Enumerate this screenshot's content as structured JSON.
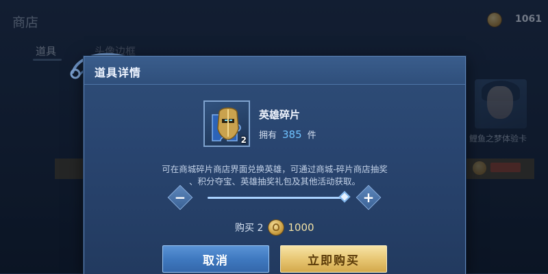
{
  "header": {
    "title": "商店",
    "coin_balance": "1061"
  },
  "tabs": [
    {
      "label": "道具",
      "active": true
    },
    {
      "label": "头像边框",
      "active": false
    }
  ],
  "side_card": {
    "label": "鲤鱼之梦体验卡"
  },
  "modal": {
    "title": "道具详情",
    "item": {
      "name": "英雄碎片",
      "icon": "hero-fragment-icon",
      "stack_count": "2",
      "own_label": "拥有",
      "own_count": "385",
      "own_unit": "件"
    },
    "description_lines": [
      "可在商城碎片商店界面兑换英雄，可通过商城-碎片商店抽奖",
      "、积分夺宝、英雄抽奖礼包及其他活动获取。"
    ],
    "quantity": {
      "minus_label": "−",
      "plus_label": "+",
      "slider_fraction": 1.0
    },
    "purchase": {
      "label": "购买 2",
      "price": "1000"
    },
    "buttons": {
      "cancel": "取消",
      "confirm": "立即购买"
    }
  },
  "colors": {
    "own_count": "#6fc3ff",
    "price": "#f3e2a6",
    "cancel_button": "#3f79c0",
    "confirm_button": "#e6c46f"
  }
}
